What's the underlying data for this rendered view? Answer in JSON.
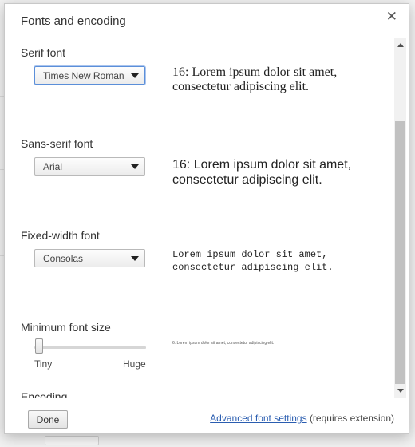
{
  "dialog": {
    "title": "Fonts and encoding"
  },
  "serif": {
    "label": "Serif font",
    "selected": "Times New Roman",
    "sample": "16: Lorem ipsum dolor sit amet, consectetur adipiscing elit."
  },
  "sans_serif": {
    "label": "Sans-serif font",
    "selected": "Arial",
    "sample": "16: Lorem ipsum dolor sit amet, consectetur adipiscing elit."
  },
  "fixed_width": {
    "label": "Fixed-width font",
    "selected": "Consolas",
    "sample": "Lorem ipsum dolor sit amet, consectetur adipiscing elit."
  },
  "minimum_font_size": {
    "label": "Minimum font size",
    "min_label": "Tiny",
    "max_label": "Huge",
    "level": 0,
    "sample": "6: Lorem ipsum dolor sit amet, consectetur adipiscing elit."
  },
  "encoding": {
    "label": "Encoding"
  },
  "footer": {
    "done_label": "Done",
    "advanced_link": "Advanced font settings",
    "advanced_note": "(requires extension)"
  },
  "icons": {
    "close": "close-icon",
    "dropdown": "chevron-down-icon",
    "scroll_up": "scroll-up-arrow-icon",
    "scroll_down": "scroll-down-arrow-icon"
  },
  "colors": {
    "link": "#2a5db0",
    "focus": "#5b8fd9"
  }
}
